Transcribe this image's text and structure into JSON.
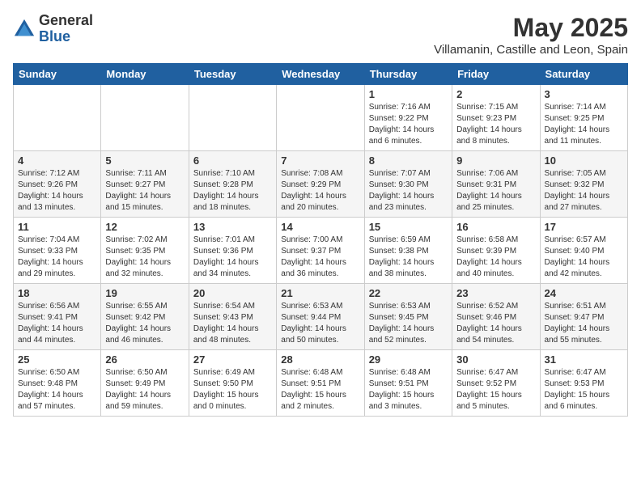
{
  "header": {
    "logo_general": "General",
    "logo_blue": "Blue",
    "month_title": "May 2025",
    "location": "Villamanin, Castille and Leon, Spain"
  },
  "weekdays": [
    "Sunday",
    "Monday",
    "Tuesday",
    "Wednesday",
    "Thursday",
    "Friday",
    "Saturday"
  ],
  "weeks": [
    [
      {
        "day": "",
        "content": ""
      },
      {
        "day": "",
        "content": ""
      },
      {
        "day": "",
        "content": ""
      },
      {
        "day": "",
        "content": ""
      },
      {
        "day": "1",
        "content": "Sunrise: 7:16 AM\nSunset: 9:22 PM\nDaylight: 14 hours\nand 6 minutes."
      },
      {
        "day": "2",
        "content": "Sunrise: 7:15 AM\nSunset: 9:23 PM\nDaylight: 14 hours\nand 8 minutes."
      },
      {
        "day": "3",
        "content": "Sunrise: 7:14 AM\nSunset: 9:25 PM\nDaylight: 14 hours\nand 11 minutes."
      }
    ],
    [
      {
        "day": "4",
        "content": "Sunrise: 7:12 AM\nSunset: 9:26 PM\nDaylight: 14 hours\nand 13 minutes."
      },
      {
        "day": "5",
        "content": "Sunrise: 7:11 AM\nSunset: 9:27 PM\nDaylight: 14 hours\nand 15 minutes."
      },
      {
        "day": "6",
        "content": "Sunrise: 7:10 AM\nSunset: 9:28 PM\nDaylight: 14 hours\nand 18 minutes."
      },
      {
        "day": "7",
        "content": "Sunrise: 7:08 AM\nSunset: 9:29 PM\nDaylight: 14 hours\nand 20 minutes."
      },
      {
        "day": "8",
        "content": "Sunrise: 7:07 AM\nSunset: 9:30 PM\nDaylight: 14 hours\nand 23 minutes."
      },
      {
        "day": "9",
        "content": "Sunrise: 7:06 AM\nSunset: 9:31 PM\nDaylight: 14 hours\nand 25 minutes."
      },
      {
        "day": "10",
        "content": "Sunrise: 7:05 AM\nSunset: 9:32 PM\nDaylight: 14 hours\nand 27 minutes."
      }
    ],
    [
      {
        "day": "11",
        "content": "Sunrise: 7:04 AM\nSunset: 9:33 PM\nDaylight: 14 hours\nand 29 minutes."
      },
      {
        "day": "12",
        "content": "Sunrise: 7:02 AM\nSunset: 9:35 PM\nDaylight: 14 hours\nand 32 minutes."
      },
      {
        "day": "13",
        "content": "Sunrise: 7:01 AM\nSunset: 9:36 PM\nDaylight: 14 hours\nand 34 minutes."
      },
      {
        "day": "14",
        "content": "Sunrise: 7:00 AM\nSunset: 9:37 PM\nDaylight: 14 hours\nand 36 minutes."
      },
      {
        "day": "15",
        "content": "Sunrise: 6:59 AM\nSunset: 9:38 PM\nDaylight: 14 hours\nand 38 minutes."
      },
      {
        "day": "16",
        "content": "Sunrise: 6:58 AM\nSunset: 9:39 PM\nDaylight: 14 hours\nand 40 minutes."
      },
      {
        "day": "17",
        "content": "Sunrise: 6:57 AM\nSunset: 9:40 PM\nDaylight: 14 hours\nand 42 minutes."
      }
    ],
    [
      {
        "day": "18",
        "content": "Sunrise: 6:56 AM\nSunset: 9:41 PM\nDaylight: 14 hours\nand 44 minutes."
      },
      {
        "day": "19",
        "content": "Sunrise: 6:55 AM\nSunset: 9:42 PM\nDaylight: 14 hours\nand 46 minutes."
      },
      {
        "day": "20",
        "content": "Sunrise: 6:54 AM\nSunset: 9:43 PM\nDaylight: 14 hours\nand 48 minutes."
      },
      {
        "day": "21",
        "content": "Sunrise: 6:53 AM\nSunset: 9:44 PM\nDaylight: 14 hours\nand 50 minutes."
      },
      {
        "day": "22",
        "content": "Sunrise: 6:53 AM\nSunset: 9:45 PM\nDaylight: 14 hours\nand 52 minutes."
      },
      {
        "day": "23",
        "content": "Sunrise: 6:52 AM\nSunset: 9:46 PM\nDaylight: 14 hours\nand 54 minutes."
      },
      {
        "day": "24",
        "content": "Sunrise: 6:51 AM\nSunset: 9:47 PM\nDaylight: 14 hours\nand 55 minutes."
      }
    ],
    [
      {
        "day": "25",
        "content": "Sunrise: 6:50 AM\nSunset: 9:48 PM\nDaylight: 14 hours\nand 57 minutes."
      },
      {
        "day": "26",
        "content": "Sunrise: 6:50 AM\nSunset: 9:49 PM\nDaylight: 14 hours\nand 59 minutes."
      },
      {
        "day": "27",
        "content": "Sunrise: 6:49 AM\nSunset: 9:50 PM\nDaylight: 15 hours\nand 0 minutes."
      },
      {
        "day": "28",
        "content": "Sunrise: 6:48 AM\nSunset: 9:51 PM\nDaylight: 15 hours\nand 2 minutes."
      },
      {
        "day": "29",
        "content": "Sunrise: 6:48 AM\nSunset: 9:51 PM\nDaylight: 15 hours\nand 3 minutes."
      },
      {
        "day": "30",
        "content": "Sunrise: 6:47 AM\nSunset: 9:52 PM\nDaylight: 15 hours\nand 5 minutes."
      },
      {
        "day": "31",
        "content": "Sunrise: 6:47 AM\nSunset: 9:53 PM\nDaylight: 15 hours\nand 6 minutes."
      }
    ]
  ]
}
